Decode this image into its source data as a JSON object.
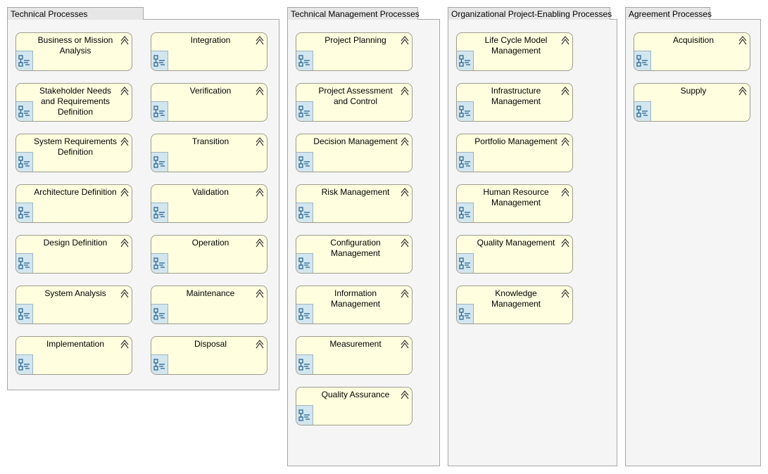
{
  "groups": [
    {
      "title": "Technical Processes",
      "processes": [
        "Business or Mission Analysis",
        "Stakeholder Needs and Requirements Definition",
        "System Requirements Definition",
        "Architecture Definition",
        "Design Definition",
        "System Analysis",
        "Implementation",
        "Integration",
        "Verification",
        "Transition",
        "Validation",
        "Operation",
        "Maintenance",
        "Disposal"
      ]
    },
    {
      "title": "Technical Management Processes",
      "processes": [
        "Project Planning",
        "Project Assessment and Control",
        "Decision Management",
        "Risk Management",
        "Configuration Management",
        "Information Management",
        "Measurement",
        "Quality Assurance"
      ]
    },
    {
      "title": "Organizational Project-Enabling Processes",
      "processes": [
        "Life Cycle Model Management",
        "Infrastructure Management",
        "Portfolio Management",
        "Human Resource Management",
        "Quality Management",
        "Knowledge Management"
      ]
    },
    {
      "title": "Agreement Processes",
      "processes": [
        "Acquisition",
        "Supply"
      ]
    }
  ],
  "icons": {
    "element_icon": "process-function-icon",
    "expand_icon": "chevron-up-icon"
  },
  "colors": {
    "process_fill": "#ffffe0",
    "icon_fill": "#d2e6f0",
    "group_fill": "#f5f5f5"
  }
}
